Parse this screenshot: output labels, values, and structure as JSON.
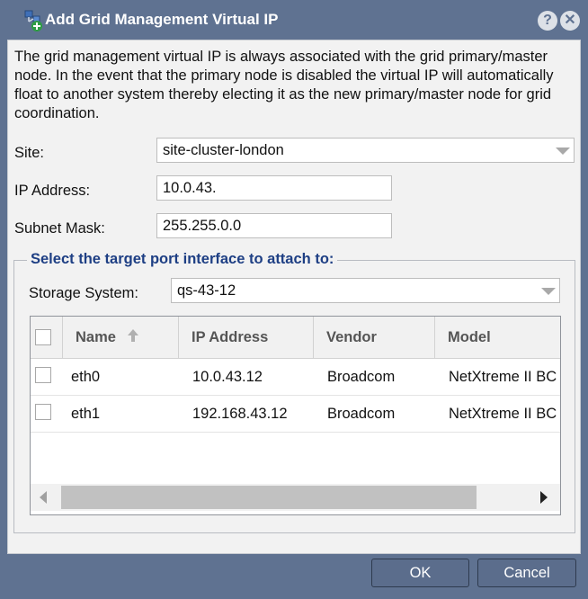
{
  "dialog": {
    "title": "Add Grid Management Virtual IP",
    "help_glyph": "?",
    "close_glyph": "✕",
    "description": "The grid management virtual IP is always associated with the grid primary/master node. In the event that the primary node is disabled the virtual IP will automatically float to another system thereby electing it as the new primary/master node for grid coordination."
  },
  "form": {
    "site_label": "Site:",
    "site_value": "site-cluster-london",
    "ip_label": "IP Address:",
    "ip_value": "10.0.43.",
    "subnet_label": "Subnet Mask:",
    "subnet_value": "255.255.0.0"
  },
  "port_section": {
    "legend": "Select the target port interface to attach to:",
    "storage_label": "Storage System:",
    "storage_value": "qs-43-12"
  },
  "grid": {
    "columns": [
      {
        "key": "name",
        "label": "Name",
        "sorted": "ascending"
      },
      {
        "key": "ip",
        "label": "IP Address"
      },
      {
        "key": "vendor",
        "label": "Vendor"
      },
      {
        "key": "model",
        "label": "Model"
      }
    ],
    "rows": [
      {
        "name": "eth0",
        "ip": "10.0.43.12",
        "vendor": "Broadcom",
        "model": "NetXtreme II BC"
      },
      {
        "name": "eth1",
        "ip": "192.168.43.12",
        "vendor": "Broadcom",
        "model": "NetXtreme II BC"
      }
    ]
  },
  "footer": {
    "ok_label": "OK",
    "cancel_label": "Cancel"
  },
  "colors": {
    "frame": "#5f7291",
    "legend_text": "#1e3f84",
    "button": "#5b6d8c"
  },
  "icons": {
    "title": "network-add-icon",
    "help": "help-icon",
    "close": "close-icon",
    "sort": "sort-ascending-icon",
    "combo": "chevron-down-icon"
  }
}
